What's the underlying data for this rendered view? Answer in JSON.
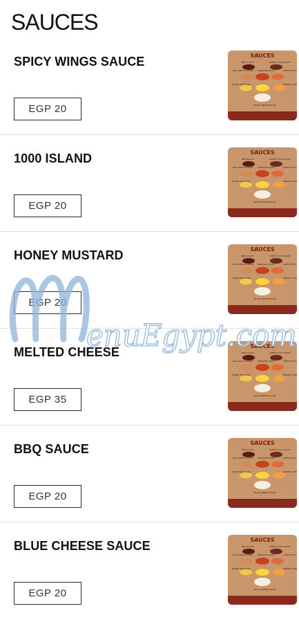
{
  "section": {
    "title": "SAUCES"
  },
  "items": [
    {
      "name": "SPICY WINGS SAUCE",
      "price": "EGP 20"
    },
    {
      "name": "1000 ISLAND",
      "price": "EGP 20"
    },
    {
      "name": "HONEY MUSTARD",
      "price": "EGP 20"
    },
    {
      "name": "MELTED CHEESE",
      "price": "EGP 35"
    },
    {
      "name": "BBQ SAUCE",
      "price": "EGP 20"
    },
    {
      "name": "BLUE CHEESE SAUCE",
      "price": "EGP 20"
    }
  ],
  "thumbnail": {
    "title": "SAUCES",
    "labels": [
      "BBQ SAUCE",
      "SWEET CHILI SAUCE",
      "CHILI GARLIC SAUCE",
      "SRIRACHA MAYO",
      "CHIPOTLE SAUCE",
      "HONEY MUSTARD",
      "MELTED CHEESE",
      "BLUE CHEESE SAUCE"
    ]
  },
  "watermark": {
    "text": "MenuEgypt.com"
  },
  "colors": {
    "thumb_bg": "#c9956a",
    "thumb_band": "#8a2a1e",
    "watermark": "#8fb4d8"
  }
}
